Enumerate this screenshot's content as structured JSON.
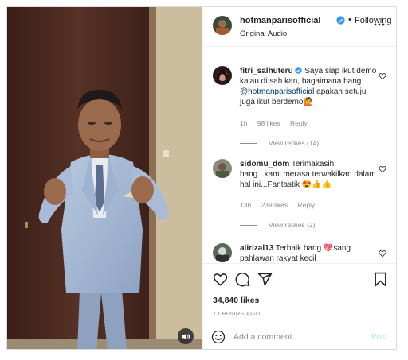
{
  "header": {
    "username": "hotmanparisofficial",
    "verified_icon": "verified-badge-icon",
    "separator": "•",
    "follow_status": "Following",
    "audio": "Original Audio",
    "more_icon": "more-horizontal-icon"
  },
  "comments": [
    {
      "username": "fitri_salhuteru",
      "verified": true,
      "text_before": "Saya siap ikut demo kalau di sah kan, bagaimana bang ",
      "mention": "@hotmanparisofficial",
      "text_after": " apakah setuju juga ikut berdemo🙋",
      "time": "1h",
      "likes": "98 likes",
      "reply": "Reply",
      "view_replies": "View replies (14)"
    },
    {
      "username": "sidomu_dom",
      "verified": false,
      "text_before": "Terimakasih bang...kami merasa terwakilkan dalam hal ini...Fantastik 😍👍👍",
      "mention": "",
      "text_after": "",
      "time": "13h",
      "likes": "239 likes",
      "reply": "Reply",
      "view_replies": "View replies (2)"
    },
    {
      "username": "alirizal13",
      "verified": false,
      "text_before": "Terbaik bang 💖sang pahlawan rakyat kecil",
      "mention": "",
      "text_after": "",
      "time": "",
      "likes": "",
      "reply": "",
      "view_replies": ""
    }
  ],
  "actions": {
    "like_icon": "heart-icon",
    "comment_icon": "comment-icon",
    "share_icon": "share-icon",
    "save_icon": "bookmark-icon",
    "likes": "34,840 likes",
    "time_ago": "13 HOURS AGO"
  },
  "add_comment": {
    "emoji_icon": "emoji-icon",
    "placeholder": "Add a comment...",
    "post_label": "Post"
  },
  "video": {
    "mute_icon": "speaker-icon"
  },
  "colors": {
    "verified": "#3897f0",
    "mention": "#00376b",
    "post_disabled": "#b2dffc",
    "muted_text": "#8e8e8e"
  }
}
